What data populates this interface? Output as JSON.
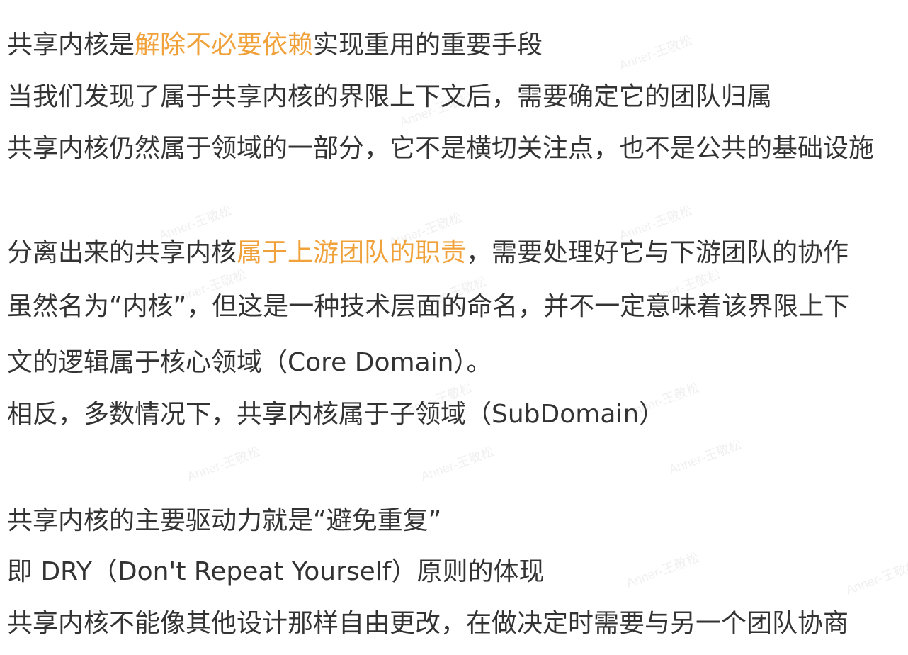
{
  "watermark": "Anner-王敬松",
  "colors": {
    "text": "#333333",
    "highlight": "#f0a13a",
    "background": "#ffffff"
  },
  "paragraphs": [
    {
      "lines": [
        {
          "segments": [
            {
              "text": "共享内核是",
              "hl": false
            },
            {
              "text": "解除不必要依赖",
              "hl": true
            },
            {
              "text": "实现重用的重要手段",
              "hl": false
            }
          ]
        },
        {
          "segments": [
            {
              "text": "当我们发现了属于共享内核的界限上下文后，需要确定它的团队归属",
              "hl": false
            }
          ]
        },
        {
          "segments": [
            {
              "text": "共享内核仍然属于领域的一部分，它不是横切关注点，也不是公共的基础设施",
              "hl": false
            }
          ]
        }
      ]
    },
    {
      "lines": [
        {
          "segments": [
            {
              "text": "分离出来的共享内核",
              "hl": false
            },
            {
              "text": "属于上游团队的职责",
              "hl": true
            },
            {
              "text": "，需要处理好它与下游团队的协作",
              "hl": false
            }
          ]
        },
        {
          "segments": [
            {
              "text": "虽然名为“内核”，但这是一种技术层面的命名，并不一定意味着该界限上下",
              "hl": false
            }
          ]
        },
        {
          "segments": [
            {
              "text": "文的逻辑属于核心领域（Core Domain）。",
              "hl": false
            }
          ]
        },
        {
          "segments": [
            {
              "text": "相反，多数情况下，共享内核属于子领域（SubDomain）",
              "hl": false
            }
          ]
        }
      ]
    },
    {
      "lines": [
        {
          "segments": [
            {
              "text": "共享内核的主要驱动力就是“避免重复”",
              "hl": false
            }
          ]
        },
        {
          "segments": [
            {
              "text": "即 DRY（Don't Repeat Yourself）原则的体现",
              "hl": false
            }
          ]
        },
        {
          "segments": [
            {
              "text": "共享内核不能像其他设计那样自由更改，在做决定时需要与另一个团队协商",
              "hl": false
            }
          ]
        }
      ]
    }
  ]
}
